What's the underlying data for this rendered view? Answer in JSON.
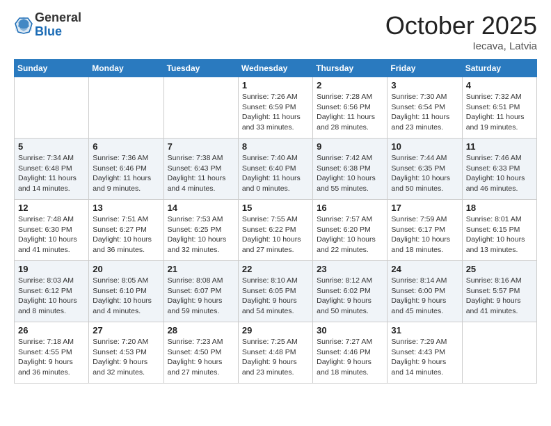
{
  "header": {
    "logo_general": "General",
    "logo_blue": "Blue",
    "month_title": "October 2025",
    "location": "Iecava, Latvia"
  },
  "days_of_week": [
    "Sunday",
    "Monday",
    "Tuesday",
    "Wednesday",
    "Thursday",
    "Friday",
    "Saturday"
  ],
  "weeks": [
    [
      {
        "day": "",
        "info": ""
      },
      {
        "day": "",
        "info": ""
      },
      {
        "day": "",
        "info": ""
      },
      {
        "day": "1",
        "info": "Sunrise: 7:26 AM\nSunset: 6:59 PM\nDaylight: 11 hours and 33 minutes."
      },
      {
        "day": "2",
        "info": "Sunrise: 7:28 AM\nSunset: 6:56 PM\nDaylight: 11 hours and 28 minutes."
      },
      {
        "day": "3",
        "info": "Sunrise: 7:30 AM\nSunset: 6:54 PM\nDaylight: 11 hours and 23 minutes."
      },
      {
        "day": "4",
        "info": "Sunrise: 7:32 AM\nSunset: 6:51 PM\nDaylight: 11 hours and 19 minutes."
      }
    ],
    [
      {
        "day": "5",
        "info": "Sunrise: 7:34 AM\nSunset: 6:48 PM\nDaylight: 11 hours and 14 minutes."
      },
      {
        "day": "6",
        "info": "Sunrise: 7:36 AM\nSunset: 6:46 PM\nDaylight: 11 hours and 9 minutes."
      },
      {
        "day": "7",
        "info": "Sunrise: 7:38 AM\nSunset: 6:43 PM\nDaylight: 11 hours and 4 minutes."
      },
      {
        "day": "8",
        "info": "Sunrise: 7:40 AM\nSunset: 6:40 PM\nDaylight: 11 hours and 0 minutes."
      },
      {
        "day": "9",
        "info": "Sunrise: 7:42 AM\nSunset: 6:38 PM\nDaylight: 10 hours and 55 minutes."
      },
      {
        "day": "10",
        "info": "Sunrise: 7:44 AM\nSunset: 6:35 PM\nDaylight: 10 hours and 50 minutes."
      },
      {
        "day": "11",
        "info": "Sunrise: 7:46 AM\nSunset: 6:33 PM\nDaylight: 10 hours and 46 minutes."
      }
    ],
    [
      {
        "day": "12",
        "info": "Sunrise: 7:48 AM\nSunset: 6:30 PM\nDaylight: 10 hours and 41 minutes."
      },
      {
        "day": "13",
        "info": "Sunrise: 7:51 AM\nSunset: 6:27 PM\nDaylight: 10 hours and 36 minutes."
      },
      {
        "day": "14",
        "info": "Sunrise: 7:53 AM\nSunset: 6:25 PM\nDaylight: 10 hours and 32 minutes."
      },
      {
        "day": "15",
        "info": "Sunrise: 7:55 AM\nSunset: 6:22 PM\nDaylight: 10 hours and 27 minutes."
      },
      {
        "day": "16",
        "info": "Sunrise: 7:57 AM\nSunset: 6:20 PM\nDaylight: 10 hours and 22 minutes."
      },
      {
        "day": "17",
        "info": "Sunrise: 7:59 AM\nSunset: 6:17 PM\nDaylight: 10 hours and 18 minutes."
      },
      {
        "day": "18",
        "info": "Sunrise: 8:01 AM\nSunset: 6:15 PM\nDaylight: 10 hours and 13 minutes."
      }
    ],
    [
      {
        "day": "19",
        "info": "Sunrise: 8:03 AM\nSunset: 6:12 PM\nDaylight: 10 hours and 8 minutes."
      },
      {
        "day": "20",
        "info": "Sunrise: 8:05 AM\nSunset: 6:10 PM\nDaylight: 10 hours and 4 minutes."
      },
      {
        "day": "21",
        "info": "Sunrise: 8:08 AM\nSunset: 6:07 PM\nDaylight: 9 hours and 59 minutes."
      },
      {
        "day": "22",
        "info": "Sunrise: 8:10 AM\nSunset: 6:05 PM\nDaylight: 9 hours and 54 minutes."
      },
      {
        "day": "23",
        "info": "Sunrise: 8:12 AM\nSunset: 6:02 PM\nDaylight: 9 hours and 50 minutes."
      },
      {
        "day": "24",
        "info": "Sunrise: 8:14 AM\nSunset: 6:00 PM\nDaylight: 9 hours and 45 minutes."
      },
      {
        "day": "25",
        "info": "Sunrise: 8:16 AM\nSunset: 5:57 PM\nDaylight: 9 hours and 41 minutes."
      }
    ],
    [
      {
        "day": "26",
        "info": "Sunrise: 7:18 AM\nSunset: 4:55 PM\nDaylight: 9 hours and 36 minutes."
      },
      {
        "day": "27",
        "info": "Sunrise: 7:20 AM\nSunset: 4:53 PM\nDaylight: 9 hours and 32 minutes."
      },
      {
        "day": "28",
        "info": "Sunrise: 7:23 AM\nSunset: 4:50 PM\nDaylight: 9 hours and 27 minutes."
      },
      {
        "day": "29",
        "info": "Sunrise: 7:25 AM\nSunset: 4:48 PM\nDaylight: 9 hours and 23 minutes."
      },
      {
        "day": "30",
        "info": "Sunrise: 7:27 AM\nSunset: 4:46 PM\nDaylight: 9 hours and 18 minutes."
      },
      {
        "day": "31",
        "info": "Sunrise: 7:29 AM\nSunset: 4:43 PM\nDaylight: 9 hours and 14 minutes."
      },
      {
        "day": "",
        "info": ""
      }
    ]
  ]
}
